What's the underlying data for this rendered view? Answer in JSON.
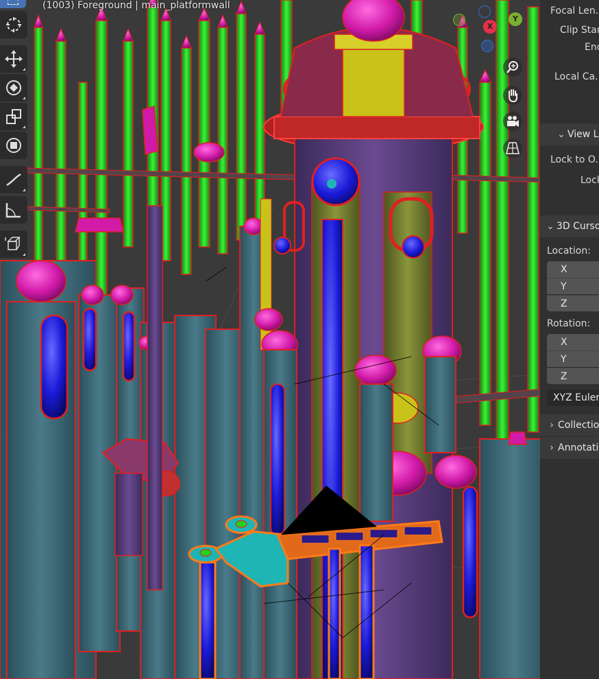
{
  "viewport": {
    "title": "(1003) Foreground | main_platformwall",
    "colors": {
      "background": "#3a3a3a",
      "pillar_green": "#22d11e",
      "pillar_teal": "#3b6876",
      "dome_magenta": "#d11aa8",
      "outline_red": "#e02020",
      "tower_olive": "#6f7a2a",
      "selection_orange": "#ff7a1a",
      "platform_cyan": "#1fb5b5",
      "deep_blue": "#1a1ad8"
    }
  },
  "toolbar": {
    "tools": [
      {
        "name": "cursor-tool-icon"
      },
      {
        "name": "move-tool-icon"
      },
      {
        "name": "rotate-tool-icon"
      },
      {
        "name": "scale-tool-icon"
      },
      {
        "name": "transform-tool-icon"
      },
      {
        "name": "annotate-tool-icon"
      },
      {
        "name": "measure-tool-icon"
      },
      {
        "name": "add-cube-tool-icon"
      }
    ]
  },
  "gizmo": {
    "x_label": "X",
    "y_label": "Y",
    "x_color": "#e5304a",
    "y_color": "#7ab02f",
    "z_color": "#2f6fd8"
  },
  "nav_buttons": [
    "zoom-icon",
    "hand-pan-icon",
    "camera-icon",
    "perspective-grid-icon"
  ],
  "npanel": {
    "focal_length_label": "Focal Len...",
    "clip_start_label": "Clip Star",
    "clip_end_label": "End",
    "local_camera_label": "Local Ca...",
    "view_lock_section": "View L",
    "lock_to_object_label": "Lock to O...",
    "lock_label": "Lock",
    "cursor_section": "3D Curso",
    "location_label": "Location:",
    "location_x": "X",
    "location_y": "Y",
    "location_z": "Z",
    "rotation_label": "Rotation:",
    "rotation_x": "X",
    "rotation_y": "Y",
    "rotation_z": "Z",
    "rotation_mode": "XYZ Euler",
    "collections_section": "Collection",
    "annotations_section": "Annotatio"
  }
}
